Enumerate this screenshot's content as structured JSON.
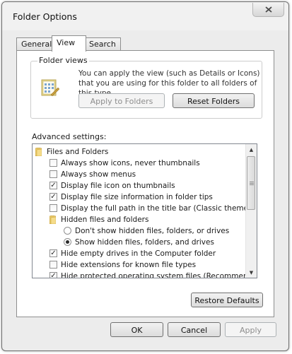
{
  "window": {
    "title": "Folder Options",
    "close_icon": "close-icon"
  },
  "tabs": [
    {
      "label": "General",
      "active": false
    },
    {
      "label": "View",
      "active": true
    },
    {
      "label": "Search",
      "active": false
    }
  ],
  "folder_views": {
    "label": "Folder views",
    "description": "You can apply the view (such as Details or Icons) that you are using for this folder to all folders of this type.",
    "apply_button": "Apply to Folders",
    "reset_button": "Reset Folders"
  },
  "advanced": {
    "label": "Advanced settings:",
    "items": [
      {
        "type": "folder",
        "label": "Files and Folders",
        "indent": 0
      },
      {
        "type": "checkbox",
        "label": "Always show icons, never thumbnails",
        "checked": false,
        "indent": 1
      },
      {
        "type": "checkbox",
        "label": "Always show menus",
        "checked": false,
        "indent": 1
      },
      {
        "type": "checkbox",
        "label": "Display file icon on thumbnails",
        "checked": true,
        "indent": 1
      },
      {
        "type": "checkbox",
        "label": "Display file size information in folder tips",
        "checked": true,
        "indent": 1
      },
      {
        "type": "checkbox",
        "label": "Display the full path in the title bar (Classic theme only)",
        "checked": false,
        "indent": 1
      },
      {
        "type": "folder",
        "label": "Hidden files and folders",
        "indent": 1
      },
      {
        "type": "radio",
        "label": "Don't show hidden files, folders, or drives",
        "checked": false,
        "indent": 2
      },
      {
        "type": "radio",
        "label": "Show hidden files, folders, and drives",
        "checked": true,
        "indent": 2
      },
      {
        "type": "checkbox",
        "label": "Hide empty drives in the Computer folder",
        "checked": true,
        "indent": 1
      },
      {
        "type": "checkbox",
        "label": "Hide extensions for known file types",
        "checked": false,
        "indent": 1
      },
      {
        "type": "checkbox",
        "label": "Hide protected operating system files (Recommended)",
        "checked": true,
        "indent": 1
      }
    ],
    "restore_button": "Restore Defaults"
  },
  "footer": {
    "ok": "OK",
    "cancel": "Cancel",
    "apply": "Apply"
  }
}
